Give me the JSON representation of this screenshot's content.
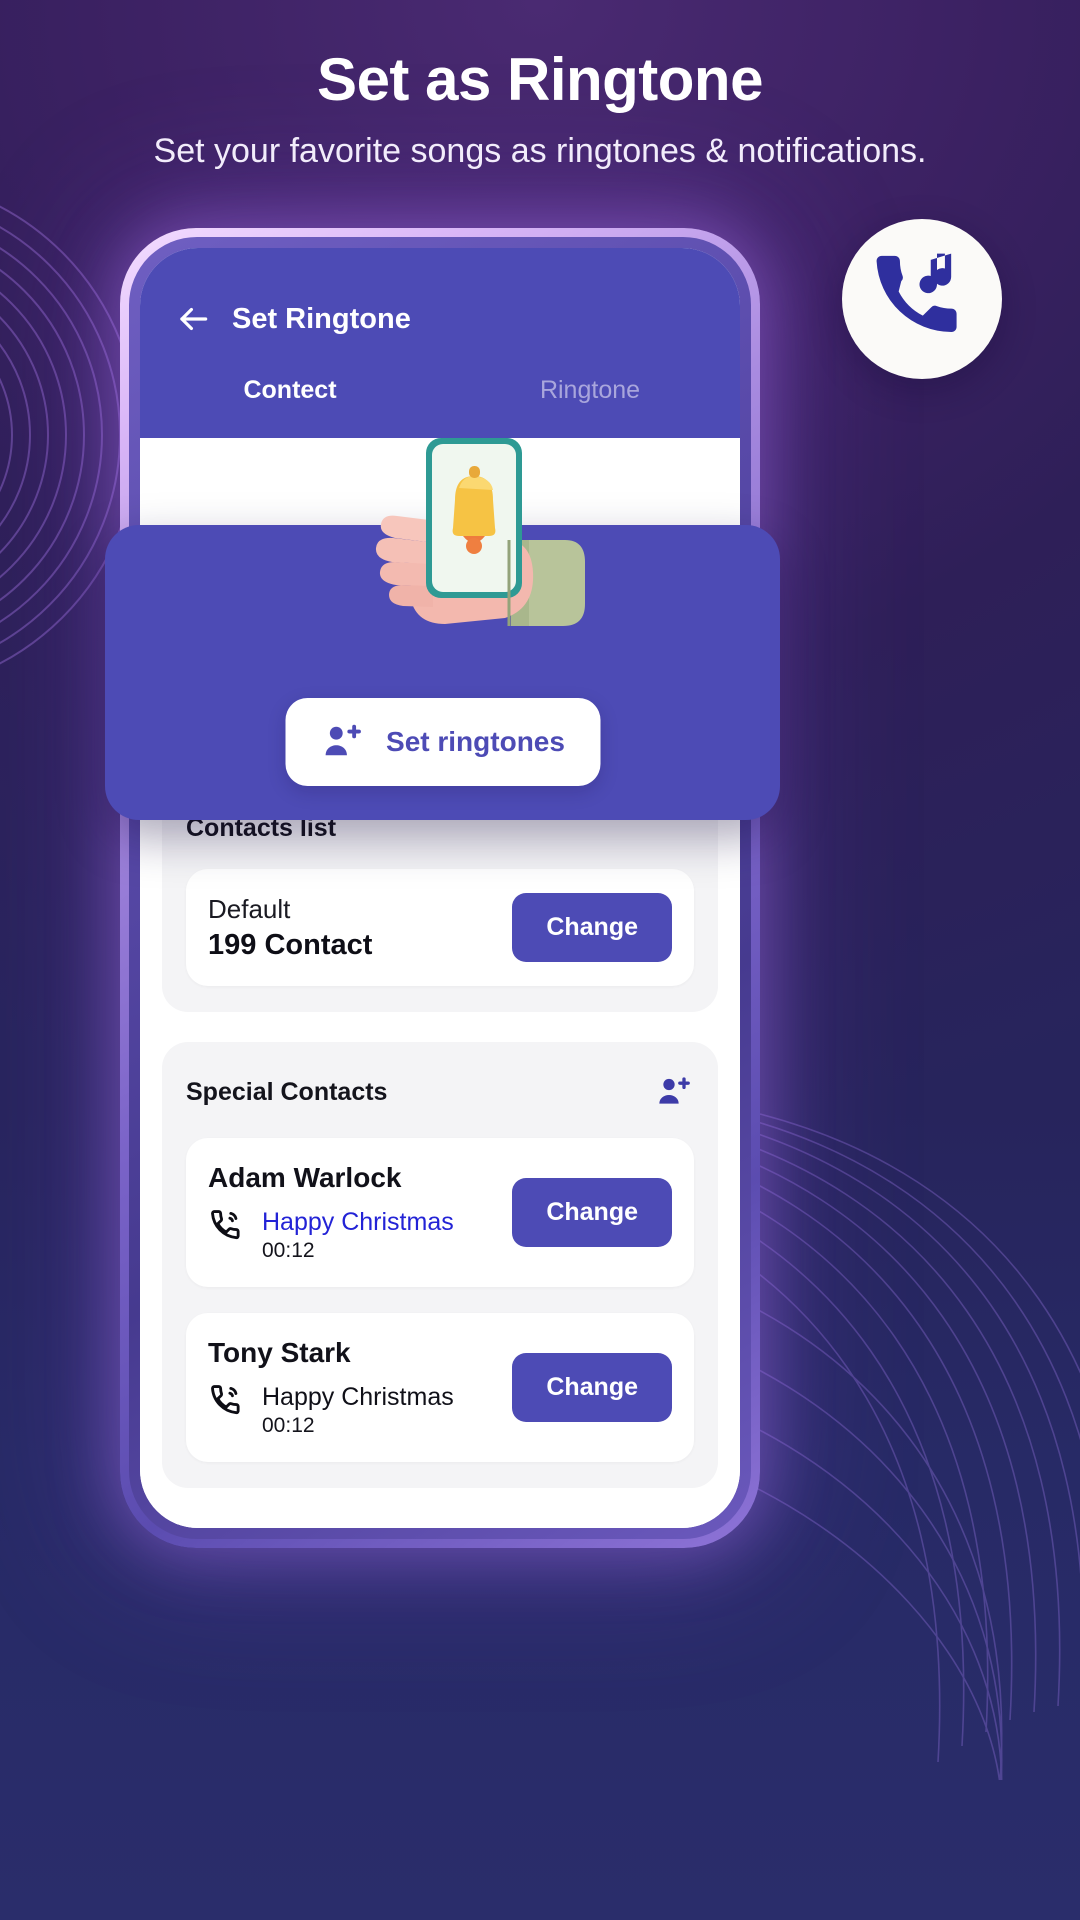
{
  "promo": {
    "headline": "Set as Ringtone",
    "subheadline": "Set your favorite songs as ringtones & notifications."
  },
  "colors": {
    "accent": "#4d4bb5",
    "highlight_link": "#2323d6",
    "page_bg_top": "#4a2a72",
    "page_bg_bottom": "#2a2d6b",
    "card_bg": "#f4f4f6",
    "row_bg": "#ffffff"
  },
  "badge": {
    "icon": "phone-music-icon"
  },
  "app": {
    "back_icon": "back-arrow-icon",
    "title": "Set Ringtone",
    "tabs": [
      {
        "label": "Contect",
        "active": true
      },
      {
        "label": "Ringtone",
        "active": false
      }
    ]
  },
  "hero": {
    "illustration": "hand-holding-phone-bell-illustration",
    "button": {
      "icon": "person-add-icon",
      "label": "Set ringtones"
    }
  },
  "contacts_list": {
    "title": "Contacts list",
    "rows": [
      {
        "sub": "Default",
        "main": "199 Contact",
        "action": "Change"
      }
    ]
  },
  "special_contacts": {
    "title": "Special Contacts",
    "add_icon": "person-add-icon",
    "rows": [
      {
        "name": "Adam Warlock",
        "tone_icon": "incoming-call-icon",
        "tone": "Happy Christmas",
        "duration": "00:12",
        "highlight": true,
        "action": "Change"
      },
      {
        "name": "Tony Stark",
        "tone_icon": "incoming-call-icon",
        "tone": "Happy Christmas",
        "duration": "00:12",
        "highlight": false,
        "action": "Change"
      }
    ]
  }
}
